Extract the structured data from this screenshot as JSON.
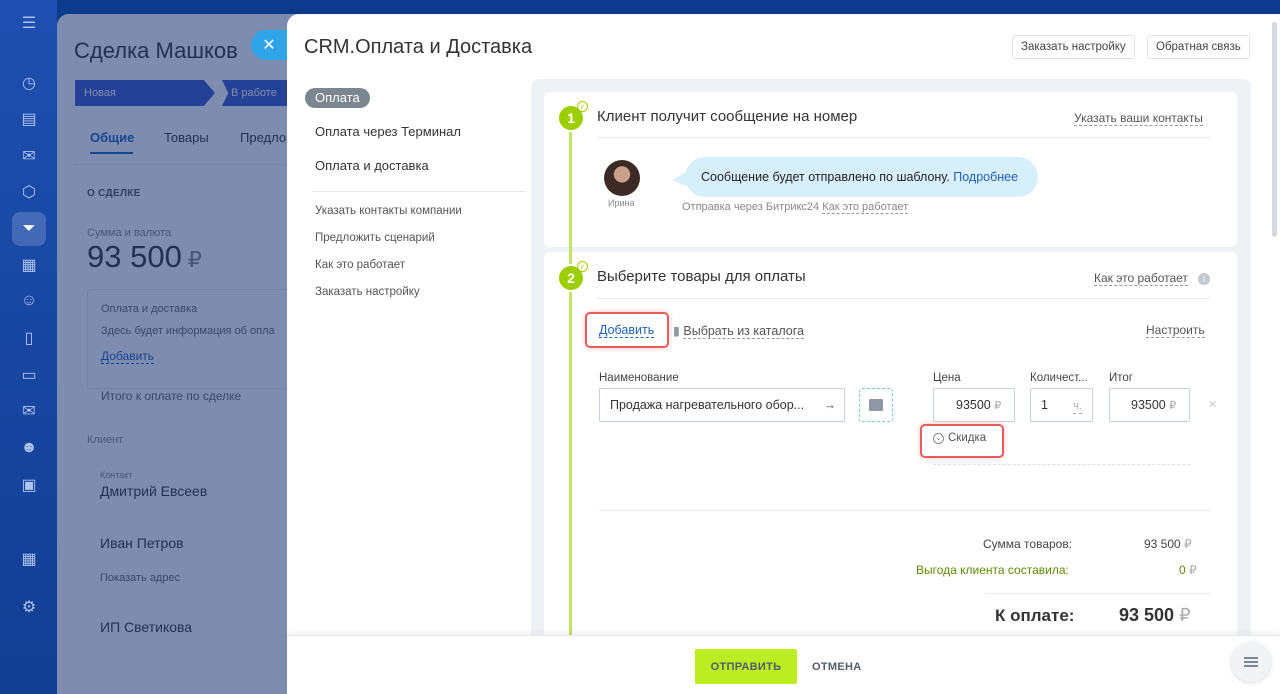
{
  "deal": {
    "title": "Сделка Машков",
    "stages": [
      "Новая",
      "В работе"
    ],
    "tabs": [
      "Общие",
      "Товары",
      "Предло"
    ],
    "section": "О СДЕЛКЕ",
    "sum_label": "Сумма и валюта",
    "sum": "93 500",
    "currency": "₽",
    "delivery_title": "Оплата и доставка",
    "delivery_info": "Здесь будет информация об опла",
    "delivery_add": "Добавить",
    "total_label": "Итого к оплате по сделке",
    "client_label": "Клиент",
    "contact_label": "Контакт",
    "contact1": "Дмитрий Евсеев",
    "contact2": "Иван Петров",
    "show_address": "Показать адрес",
    "company": "ИП Светикова"
  },
  "panel": {
    "title": "CRM.Оплата и Доставка",
    "btn_order_setup": "Заказать настройку",
    "btn_feedback": "Обратная связь"
  },
  "menu": {
    "active": "Оплата",
    "items": [
      "Оплата через Терминал",
      "Оплата и доставка"
    ],
    "sub": [
      "Указать контакты компании",
      "Предложить сценарий",
      "Как это работает",
      "Заказать настройку"
    ]
  },
  "step1": {
    "number": "1",
    "title": "Клиент получит сообщение на номер",
    "link": "Указать ваши контакты",
    "avatar_name": "Ирина",
    "message": "Сообщение будет отправлено по шаблону.",
    "message_link": "Подробнее",
    "via": "Отправка через Битрикс24",
    "via_link": "Как это работает"
  },
  "step2": {
    "number": "2",
    "title": "Выберите товары для оплаты",
    "how_link": "Как это работает",
    "add": "Добавить",
    "catalog": "Выбрать из каталога",
    "configure": "Настроить",
    "col_name": "Наименование",
    "col_price": "Цена",
    "col_qty": "Количест...",
    "col_total": "Итог",
    "product_name": "Продажа нагревательного обор...",
    "price": "93500",
    "qty": "1",
    "qty_unit": "ч.",
    "total": "93500",
    "currency": "₽",
    "discount": "Скидка"
  },
  "totals": {
    "goods_label": "Сумма товаров:",
    "goods_value": "93 500",
    "benefit_label": "Выгода клиента составила:",
    "benefit_value": "0",
    "currency": "₽",
    "grand_label": "К оплате:",
    "grand_value": "93 500"
  },
  "footer": {
    "send": "ОТПРАВИТЬ",
    "cancel": "ОТМЕНА"
  },
  "colors": {
    "accent_green": "#bbed21",
    "step_green": "#9dcf00",
    "link_blue": "#1f5fb8",
    "highlight_red": "#e45c5c"
  }
}
